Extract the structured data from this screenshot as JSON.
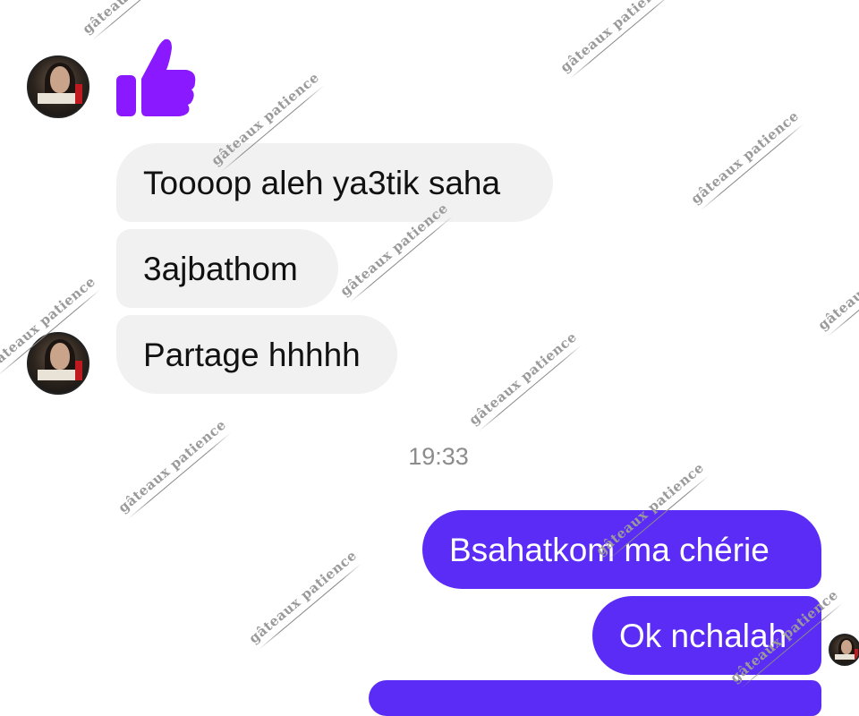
{
  "colors": {
    "accent": "#5b2cf6",
    "like": "#8a19ff",
    "incoming_bg": "#f1f1f1"
  },
  "watermark": "gâteaux patience",
  "messages": {
    "like_icon": "thumbs-up-icon",
    "incoming": [
      {
        "text": "Toooop aleh ya3tik saha"
      },
      {
        "text": "3ajbathom"
      },
      {
        "text": "Partage hhhhh"
      }
    ],
    "timestamp": "19:33",
    "outgoing": [
      {
        "text": "Bsahatkom ma chérie"
      },
      {
        "text": "Ok nchalah"
      }
    ]
  }
}
